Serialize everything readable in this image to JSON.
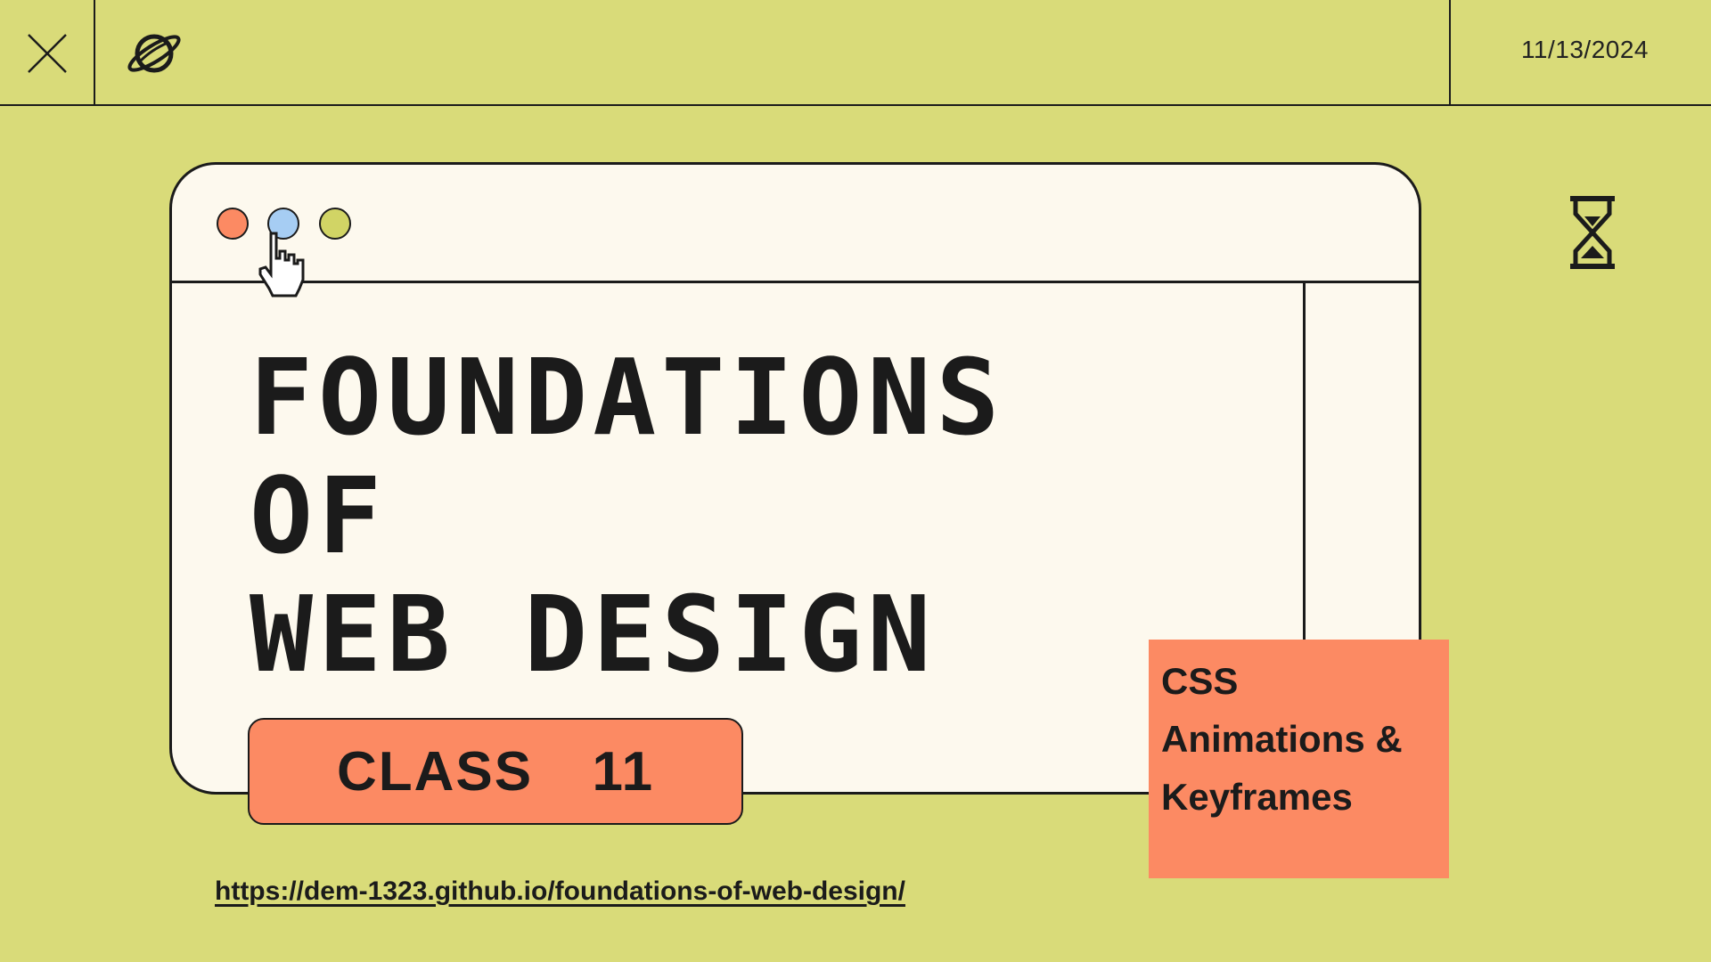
{
  "header": {
    "date": "11/13/2024",
    "close_icon": "close-icon",
    "planet_icon": "planet-icon"
  },
  "window": {
    "controls": [
      {
        "name": "red",
        "color": "#fc8a63"
      },
      {
        "name": "blue",
        "color": "#a6cdf3"
      },
      {
        "name": "yellow",
        "color": "#d1d465"
      }
    ],
    "cursor_icon": "hand-pointer-icon",
    "title_lines": [
      "FOUNDATIONS",
      "OF",
      "WEB DESIGN"
    ]
  },
  "class_badge": {
    "label": "CLASS  11"
  },
  "topic": {
    "lines": [
      "CSS",
      "Animations &",
      "Keyframes"
    ]
  },
  "link": {
    "text": "https://dem-1323.github.io/foundations-of-web-design/"
  },
  "decor": {
    "hourglass_icon": "hourglass-icon"
  },
  "colors": {
    "background": "#d9db79",
    "card": "#fdf9ee",
    "accent": "#fc8a63",
    "ink": "#1b1b1b"
  }
}
